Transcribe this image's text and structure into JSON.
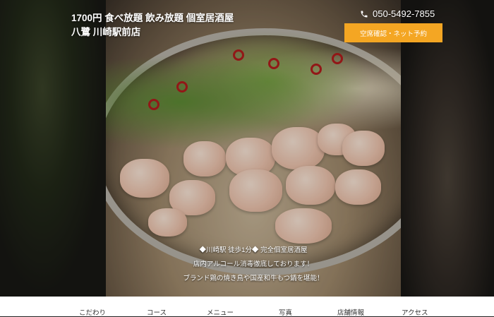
{
  "header": {
    "title_line1": "1700円 食べ放題 飲み放題 個室居酒屋",
    "title_line2": "八鷺 川崎駅前店",
    "phone_icon": "phone-icon",
    "phone": "050-5492-7855",
    "reserve_label": "空席確認・ネット予約"
  },
  "hero": {
    "caption1": "◆川崎駅 徒歩1分◆ 完全個室居酒屋",
    "caption2": "店内アルコール消毒徹底しております！",
    "caption3": "ブランド鶏の焼き鳥や国産和牛もつ鍋を堪能！"
  },
  "nav": {
    "items": [
      {
        "label": "こだわり"
      },
      {
        "label": "コース"
      },
      {
        "label": "メニュー"
      },
      {
        "label": "写真"
      },
      {
        "label": "店舗情報"
      },
      {
        "label": "アクセス"
      }
    ]
  },
  "colors": {
    "accent": "#f4a623",
    "nav_text": "#333333"
  }
}
